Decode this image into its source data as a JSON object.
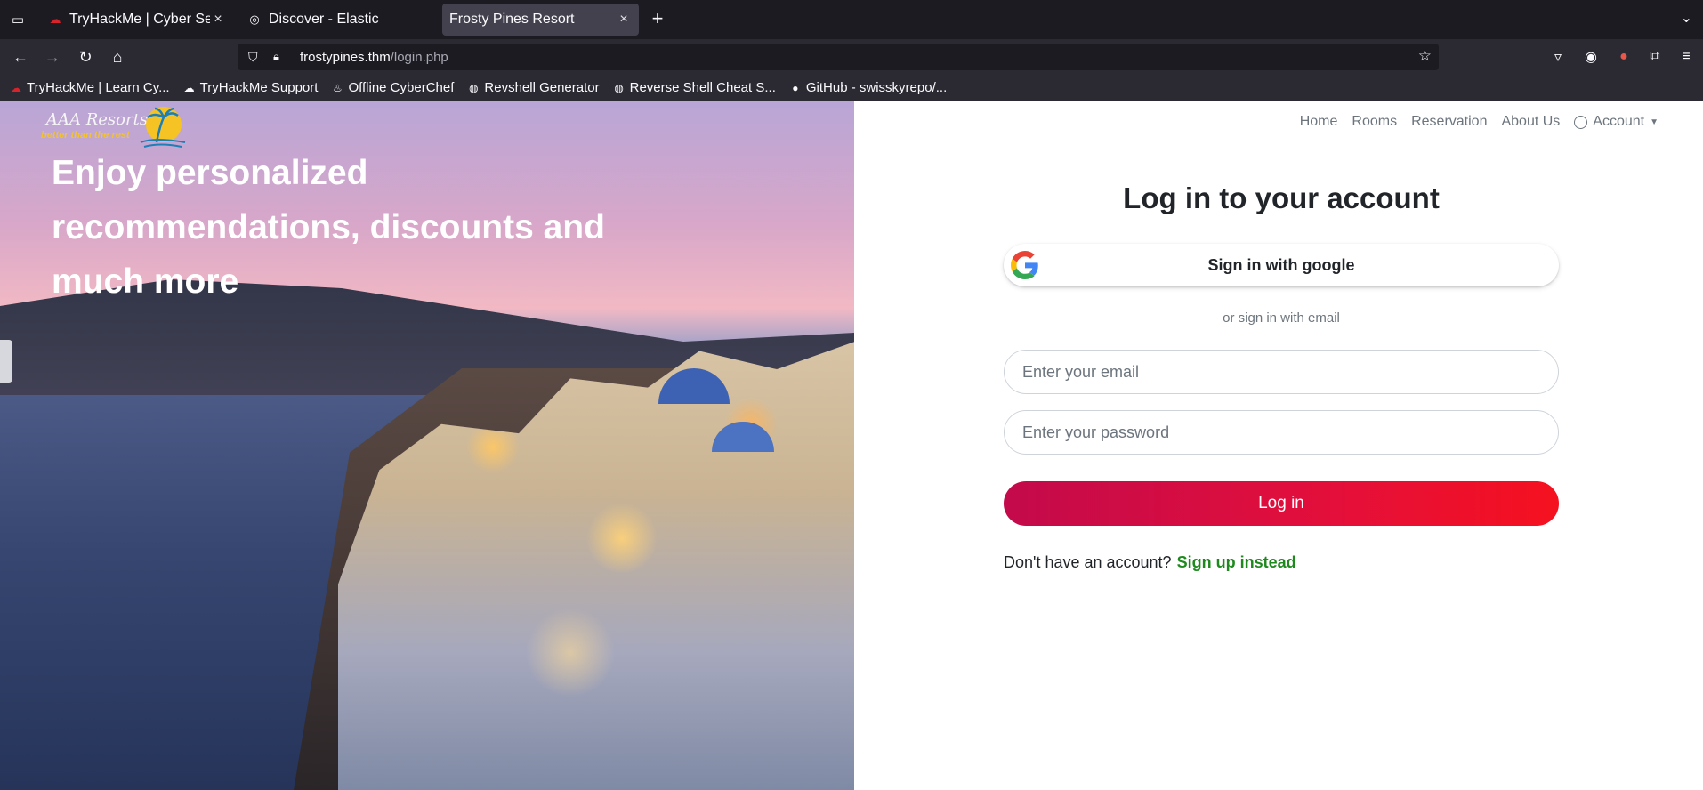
{
  "browser": {
    "tabs": [
      {
        "title": "TryHackMe | Cyber Securi",
        "active": false
      },
      {
        "title": "Discover - Elastic",
        "active": false
      },
      {
        "title": "Frosty Pines Resort",
        "active": true
      }
    ],
    "url_host": "frostypines.thm",
    "url_path": "/login.php",
    "bookmarks": [
      "TryHackMe | Learn Cy...",
      "TryHackMe Support",
      "Offline CyberChef",
      "Revshell Generator",
      "Reverse Shell Cheat S...",
      "GitHub - swisskyrepo/..."
    ]
  },
  "site": {
    "logo_text": "AAA Resorts",
    "logo_tagline": "better than the rest",
    "hero_heading": "Enjoy personalized recommendations, discounts and much more",
    "nav": {
      "home": "Home",
      "rooms": "Rooms",
      "reservation": "Reservation",
      "about": "About Us",
      "account": "Account"
    }
  },
  "login": {
    "title": "Log in to your account",
    "google_label": "Sign in with google",
    "or_text": "or sign in with email",
    "email_placeholder": "Enter your email",
    "password_placeholder": "Enter your password",
    "submit_label": "Log in",
    "no_account_text": "Don't have an account?",
    "signup_link": "Sign up instead"
  },
  "colors": {
    "accent_gradient_start": "#c30a4b",
    "accent_gradient_end": "#f5111f",
    "signup_link": "#1e8a1e"
  }
}
